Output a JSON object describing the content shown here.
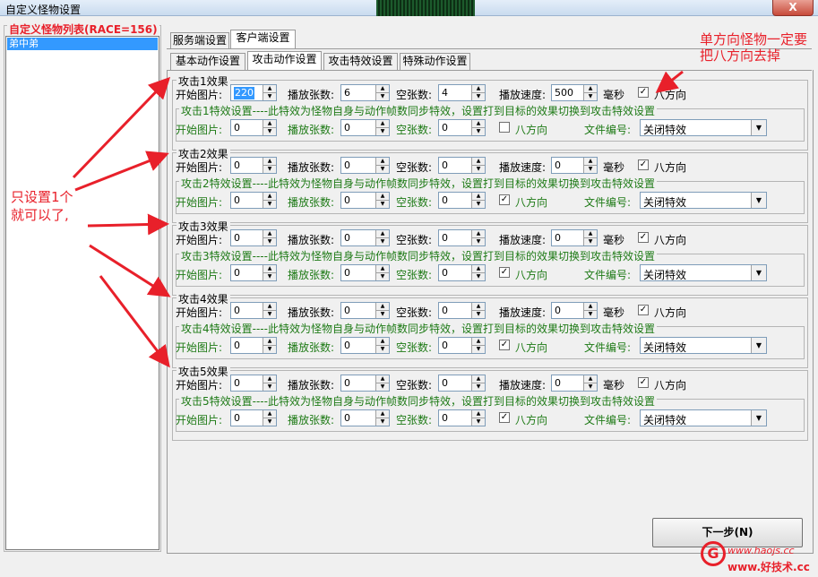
{
  "window": {
    "title": "自定义怪物设置",
    "close_label": "X"
  },
  "monster_list": {
    "title": "自定义怪物列表(RACE=156)",
    "items": [
      "弟中弟"
    ],
    "selected": "弟中弟"
  },
  "tabs_top": [
    {
      "label": "服务端设置",
      "active": false
    },
    {
      "label": "客户端设置",
      "active": true
    }
  ],
  "tabs_sub": [
    {
      "label": "基本动作设置",
      "active": false
    },
    {
      "label": "攻击动作设置",
      "active": true
    },
    {
      "label": "攻击特效设置",
      "active": false
    },
    {
      "label": "特殊动作设置",
      "active": false
    }
  ],
  "labels": {
    "start_pic": "开始图片:",
    "play_count": "播放张数:",
    "blank_count": "空张数:",
    "play_speed": "播放速度:",
    "ms": "毫秒",
    "eight_dir": "八方向",
    "file_no": "文件编号:"
  },
  "effects": [
    {
      "title": "攻击1效果",
      "start": "220",
      "play": "6",
      "blank": "4",
      "speed": "500",
      "eight_dir": true,
      "sub_title": "攻击1特效设置----此特效为怪物自身与动作帧数同步特效，设置打到目标的效果切换到攻击特效设置",
      "sub_start": "0",
      "sub_play": "0",
      "sub_blank": "0",
      "sub_eight_dir": false,
      "file": "关闭特效"
    },
    {
      "title": "攻击2效果",
      "start": "0",
      "play": "0",
      "blank": "0",
      "speed": "0",
      "eight_dir": true,
      "sub_title": "攻击2特效设置----此特效为怪物自身与动作帧数同步特效，设置打到目标的效果切换到攻击特效设置",
      "sub_start": "0",
      "sub_play": "0",
      "sub_blank": "0",
      "sub_eight_dir": true,
      "file": "关闭特效"
    },
    {
      "title": "攻击3效果",
      "start": "0",
      "play": "0",
      "blank": "0",
      "speed": "0",
      "eight_dir": true,
      "sub_title": "攻击3特效设置----此特效为怪物自身与动作帧数同步特效，设置打到目标的效果切换到攻击特效设置",
      "sub_start": "0",
      "sub_play": "0",
      "sub_blank": "0",
      "sub_eight_dir": true,
      "file": "关闭特效"
    },
    {
      "title": "攻击4效果",
      "start": "0",
      "play": "0",
      "blank": "0",
      "speed": "0",
      "eight_dir": true,
      "sub_title": "攻击4特效设置----此特效为怪物自身与动作帧数同步特效，设置打到目标的效果切换到攻击特效设置",
      "sub_start": "0",
      "sub_play": "0",
      "sub_blank": "0",
      "sub_eight_dir": true,
      "file": "关闭特效"
    },
    {
      "title": "攻击5效果",
      "start": "0",
      "play": "0",
      "blank": "0",
      "speed": "0",
      "eight_dir": true,
      "sub_title": "攻击5特效设置----此特效为怪物自身与动作帧数同步特效，设置打到目标的效果切换到攻击特效设置",
      "sub_start": "0",
      "sub_play": "0",
      "sub_blank": "0",
      "sub_eight_dir": true,
      "file": "关闭特效"
    }
  ],
  "next_button": "下一步(N)",
  "annotations": {
    "top_right_line1": "单方向怪物一定要",
    "top_right_line2": "把八方向去掉",
    "left_line1": "只设置1个",
    "left_line2": "就可以了,"
  },
  "watermark": {
    "line1": "www.haojs.cc",
    "line2": "www.好技术.cc"
  },
  "colors": {
    "annotation": "#e8202a",
    "sub_text": "#1e7a16",
    "selection": "#3399ff"
  }
}
